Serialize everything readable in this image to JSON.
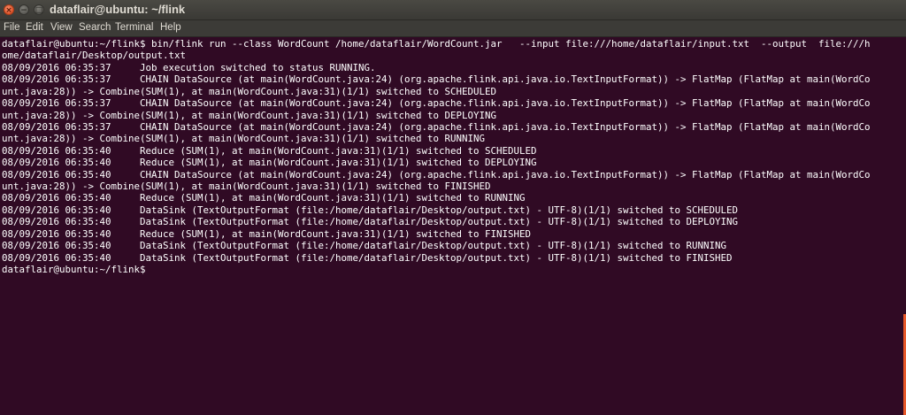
{
  "window": {
    "title": "dataflair@ubuntu: ~/flink",
    "close_glyph": "×",
    "minimize_glyph": "−",
    "maximize_glyph": "□"
  },
  "menu": [
    "File",
    "Edit",
    "View",
    "Search",
    "Terminal",
    "Help"
  ],
  "terminal_lines": [
    "dataflair@ubuntu:~/flink$ bin/flink run --class WordCount /home/dataflair/WordCount.jar   --input file:///home/dataflair/input.txt  --output  file:///h",
    "ome/dataflair/Desktop/output.txt",
    "08/09/2016 06:35:37\tJob execution switched to status RUNNING.",
    "08/09/2016 06:35:37\tCHAIN DataSource (at main(WordCount.java:24) (org.apache.flink.api.java.io.TextInputFormat)) -> FlatMap (FlatMap at main(WordCo",
    "unt.java:28)) -> Combine(SUM(1), at main(WordCount.java:31)(1/1) switched to SCHEDULED",
    "08/09/2016 06:35:37\tCHAIN DataSource (at main(WordCount.java:24) (org.apache.flink.api.java.io.TextInputFormat)) -> FlatMap (FlatMap at main(WordCo",
    "unt.java:28)) -> Combine(SUM(1), at main(WordCount.java:31)(1/1) switched to DEPLOYING",
    "08/09/2016 06:35:37\tCHAIN DataSource (at main(WordCount.java:24) (org.apache.flink.api.java.io.TextInputFormat)) -> FlatMap (FlatMap at main(WordCo",
    "unt.java:28)) -> Combine(SUM(1), at main(WordCount.java:31)(1/1) switched to RUNNING",
    "08/09/2016 06:35:40\tReduce (SUM(1), at main(WordCount.java:31)(1/1) switched to SCHEDULED",
    "08/09/2016 06:35:40\tReduce (SUM(1), at main(WordCount.java:31)(1/1) switched to DEPLOYING",
    "08/09/2016 06:35:40\tCHAIN DataSource (at main(WordCount.java:24) (org.apache.flink.api.java.io.TextInputFormat)) -> FlatMap (FlatMap at main(WordCo",
    "unt.java:28)) -> Combine(SUM(1), at main(WordCount.java:31)(1/1) switched to FINISHED",
    "08/09/2016 06:35:40\tReduce (SUM(1), at main(WordCount.java:31)(1/1) switched to RUNNING",
    "08/09/2016 06:35:40\tDataSink (TextOutputFormat (file:/home/dataflair/Desktop/output.txt) - UTF-8)(1/1) switched to SCHEDULED",
    "08/09/2016 06:35:40\tDataSink (TextOutputFormat (file:/home/dataflair/Desktop/output.txt) - UTF-8)(1/1) switched to DEPLOYING",
    "08/09/2016 06:35:40\tReduce (SUM(1), at main(WordCount.java:31)(1/1) switched to FINISHED",
    "08/09/2016 06:35:40\tDataSink (TextOutputFormat (file:/home/dataflair/Desktop/output.txt) - UTF-8)(1/1) switched to RUNNING",
    "08/09/2016 06:35:40\tDataSink (TextOutputFormat (file:/home/dataflair/Desktop/output.txt) - UTF-8)(1/1) switched to FINISHED",
    "dataflair@ubuntu:~/flink$"
  ],
  "colors": {
    "terminal_background": "#300a24",
    "terminal_foreground": "#ffffff",
    "close_button": "#e0552b",
    "scrollbar_accent": "#e8592a"
  }
}
